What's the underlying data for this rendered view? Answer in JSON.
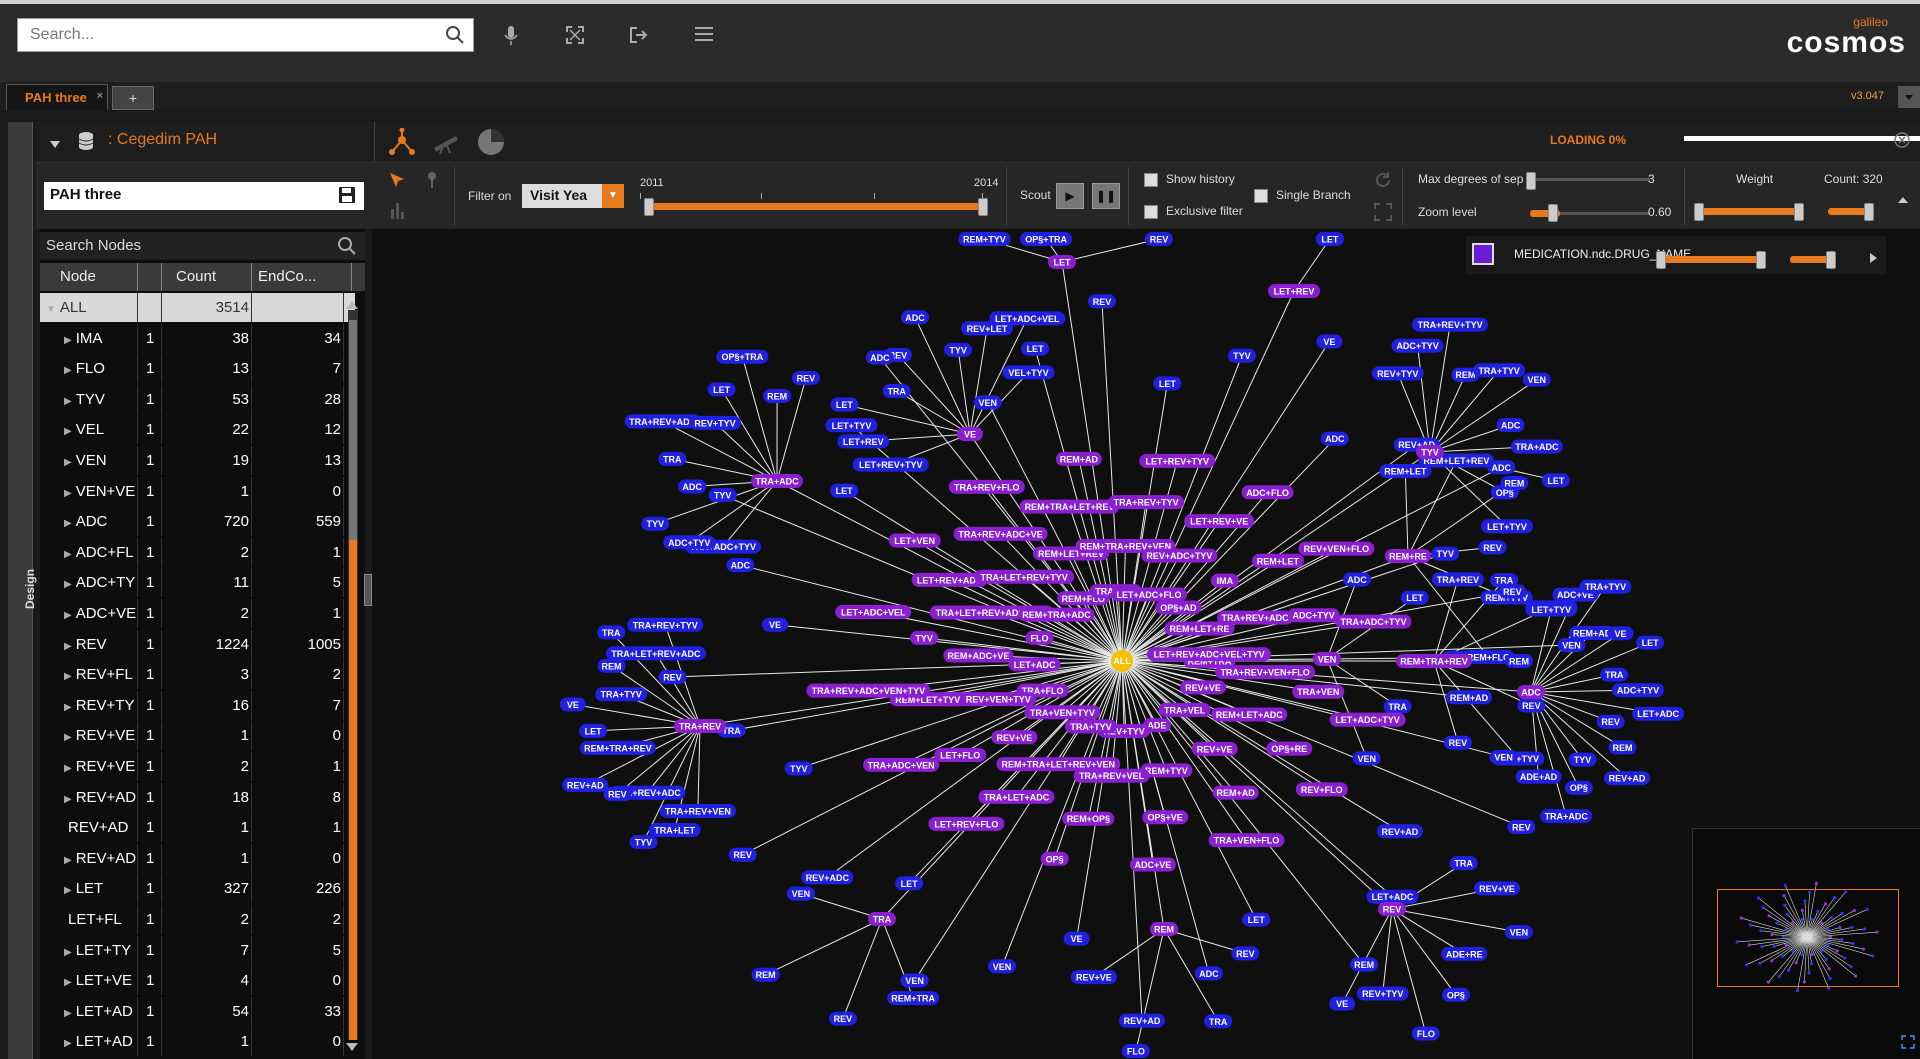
{
  "toolbar": {
    "search_placeholder": "Search...",
    "logo_small": "galileo",
    "logo_big": "cosmos"
  },
  "tabs": {
    "active_label": "PAH three",
    "close": "×",
    "add_label": "+",
    "version": "v3.047"
  },
  "sidebar_label": "Design",
  "header": {
    "dataset": ": Cegedim PAH",
    "loading": "LOADING 0%"
  },
  "filters": {
    "name_value": "PAH three",
    "filter_on": "Filter on",
    "select_value": "Visit Yea",
    "year_start": "2011",
    "year_end": "2014",
    "scout": "Scout",
    "show_history": "Show history",
    "exclusive_filter": "Exclusive filter",
    "single_branch": "Single Branch",
    "max_degrees": "Max degrees of sep",
    "max_degrees_val": "3",
    "zoom_level": "Zoom level",
    "zoom_val": "0.60",
    "weight": "Weight",
    "count": "Count: 320"
  },
  "legend_item": "MEDICATION.ndc.DRUG_NAME...",
  "nodes_panel": {
    "search": "Search Nodes",
    "col_node": "Node",
    "col_count": "Count",
    "col_end": "EndCo...",
    "rows": [
      {
        "toggle": "▼",
        "name": "ALL",
        "lvl": "",
        "count": "3514",
        "end": ""
      },
      {
        "toggle": "▶",
        "name": "IMA",
        "lvl": "1",
        "count": "38",
        "end": "34"
      },
      {
        "toggle": "▶",
        "name": "FLO",
        "lvl": "1",
        "count": "13",
        "end": "7"
      },
      {
        "toggle": "▶",
        "name": "TYV",
        "lvl": "1",
        "count": "53",
        "end": "28"
      },
      {
        "toggle": "▶",
        "name": "VEL",
        "lvl": "1",
        "count": "22",
        "end": "12"
      },
      {
        "toggle": "▶",
        "name": "VEN",
        "lvl": "1",
        "count": "19",
        "end": "13"
      },
      {
        "toggle": "▶",
        "name": "VEN+VE",
        "lvl": "1",
        "count": "1",
        "end": "0"
      },
      {
        "toggle": "▶",
        "name": "ADC",
        "lvl": "1",
        "count": "720",
        "end": "559"
      },
      {
        "toggle": "▶",
        "name": "ADC+FL",
        "lvl": "1",
        "count": "2",
        "end": "1"
      },
      {
        "toggle": "▶",
        "name": "ADC+TY",
        "lvl": "1",
        "count": "11",
        "end": "5"
      },
      {
        "toggle": "▶",
        "name": "ADC+VE",
        "lvl": "1",
        "count": "2",
        "end": "1"
      },
      {
        "toggle": "▶",
        "name": "REV",
        "lvl": "1",
        "count": "1224",
        "end": "1005"
      },
      {
        "toggle": "▶",
        "name": "REV+FL",
        "lvl": "1",
        "count": "3",
        "end": "2"
      },
      {
        "toggle": "▶",
        "name": "REV+TY",
        "lvl": "1",
        "count": "16",
        "end": "7"
      },
      {
        "toggle": "▶",
        "name": "REV+VE",
        "lvl": "1",
        "count": "1",
        "end": "0"
      },
      {
        "toggle": "▶",
        "name": "REV+VE",
        "lvl": "1",
        "count": "2",
        "end": "1"
      },
      {
        "toggle": "▶",
        "name": "REV+AD",
        "lvl": "1",
        "count": "18",
        "end": "8"
      },
      {
        "toggle": "",
        "name": "REV+AD",
        "lvl": "1",
        "count": "1",
        "end": "1"
      },
      {
        "toggle": "▶",
        "name": "REV+AD",
        "lvl": "1",
        "count": "1",
        "end": "0"
      },
      {
        "toggle": "▶",
        "name": "LET",
        "lvl": "1",
        "count": "327",
        "end": "226"
      },
      {
        "toggle": "",
        "name": "LET+FL",
        "lvl": "1",
        "count": "2",
        "end": "2"
      },
      {
        "toggle": "▶",
        "name": "LET+TY",
        "lvl": "1",
        "count": "7",
        "end": "5"
      },
      {
        "toggle": "▶",
        "name": "LET+VE",
        "lvl": "1",
        "count": "4",
        "end": "0"
      },
      {
        "toggle": "▶",
        "name": "LET+AD",
        "lvl": "1",
        "count": "54",
        "end": "33"
      },
      {
        "toggle": "▶",
        "name": "LET+AD",
        "lvl": "1",
        "count": "1",
        "end": "0"
      }
    ]
  },
  "graph": {
    "center": "ALL",
    "hubs": [
      {
        "label": "TRA+ADC",
        "leaves": [
          "TRA+ADC+TYV",
          "ADC+TYV",
          "TYV",
          "ADC",
          "TRA",
          "TRA+REV+ADC",
          "REV+TYV",
          "LET",
          "OP§+TRA",
          "REM",
          "REV"
        ]
      },
      {
        "label": "VE",
        "leaves": [
          "LET+REV+TYV",
          "LET+REV",
          "LET",
          "TRA",
          "REV",
          "ADC",
          "TYV",
          "REV+LET",
          "LET+ADC+VEL",
          "VEL+TYV"
        ]
      },
      {
        "label": "LET",
        "leaves": [
          "REM+TYV",
          "OP§+TRA",
          "REV"
        ]
      },
      {
        "label": "LET+REV",
        "leaves": [
          "LET"
        ]
      },
      {
        "label": "TYV",
        "leaves": [
          "REV+TYV",
          "ADC+TYV",
          "TRA+REV+TYV",
          "REM",
          "TRA+TYV",
          "VEN",
          "ADC",
          "TRA+ADC",
          "LET",
          "OP§",
          "LET+TYV"
        ]
      },
      {
        "label": "REM+RE",
        "leaves": [
          "REM+LET",
          "REM+LET+REV",
          "REM",
          "REV",
          "REM+TYV",
          "REM+FLO"
        ]
      },
      {
        "label": "REM+TRA+REV",
        "leaves": [
          "TRA+REV",
          "TRA",
          "REM+TRA",
          "REM",
          "REV",
          "VEN+TYV",
          "REV"
        ]
      },
      {
        "label": "VEN",
        "leaves": [
          "ADC",
          "LET",
          "VE",
          "TRA",
          "VEN"
        ]
      },
      {
        "label": "ADC",
        "leaves": [
          "LET+TYV",
          "ADC+VE",
          "TRA+TYV",
          "REM+AD",
          "VE",
          "LET",
          "TRA",
          "ADC+TYV",
          "LET+ADC",
          "REV",
          "REM",
          "REV+AD",
          "TYV",
          "OP§",
          "TRA+ADC",
          "ADE+AD"
        ]
      },
      {
        "label": "TRA+REV",
        "leaves": [
          "TRA+REV+VEN",
          "TRA+LET",
          "TYV",
          "TRA+REV+ADC",
          "REV",
          "REV+AD",
          "REM+TRA+REV",
          "LET",
          "VE",
          "TRA+TYV",
          "REM",
          "TRA",
          "TRA+LET+REV+ADC",
          "TRA+REV+TYV"
        ]
      },
      {
        "label": "REV",
        "leaves": [
          "TRA",
          "REV+VE",
          "VEN",
          "ADE+RE",
          "OP§",
          "FLO",
          "REV+TYV",
          "VE"
        ]
      },
      {
        "label": "TRA",
        "leaves": [
          "REM+TRA",
          "REV",
          "REM",
          "VEN"
        ]
      },
      {
        "label": "REM",
        "leaves": [
          "REV",
          "TRA",
          "FLO",
          "REV+VE"
        ]
      }
    ],
    "ring": [
      "REM+TRA",
      "TRA+REV+VEN+FLO",
      "TRA+VEN",
      "LET+ADC+TYV",
      "REV+VE",
      "REM+LET+ADC",
      "OP§+RE",
      "REV+FLO",
      "TRA+VEL",
      "REV+VE",
      "REM+AD",
      "TRA+VEN+FLO",
      "ADE",
      "REM+TYV",
      "OP§+VE",
      "ADC+VE",
      "REV+TYV",
      "TRA+REV+VEL",
      "REM+OP§",
      "OP§",
      "TRA+TYV",
      "REM+TRA+LET+REV+VEN",
      "TRA+LET+ADC",
      "LET+REV+FLO",
      "TRA+VEN+TYV",
      "REV+VE",
      "LET+FLO",
      "TRA+ADC+VEN",
      "TRA+FLO",
      "TRA+REV+VEN+TYV",
      "REM+LET+TYV",
      "TRA+REV+ADC+VEN+TYV",
      "LET+ADC",
      "REM+ADC+VE",
      "TYV",
      "LET+ADC+VEL",
      "FLO",
      "TRA+LET+REV+ADC+TYV",
      "LET+REV+ADC",
      "LET+VEN",
      "REM+TRA+ADC",
      "TRA+LET+REV+TYV",
      "TRA+REV+ADC+VE",
      "TRA+REV+FLO",
      "REM+FLO",
      "REM+LET+REV",
      "REM+TRA+LET+REV",
      "REM+AD",
      "TRA+LET",
      "REM+TRA+REV+VEN",
      "TRA+REV+TYV",
      "LET+REV+TYV",
      "LET+ADC+FLO",
      "REV+ADC+TYV",
      "LET+REV+VE",
      "ADC+FLO",
      "OP§+AD",
      "IMA",
      "REM+LET",
      "REV+VEN+FLO",
      "REM+LET+RE",
      "TRA+REV+ADC",
      "ADC+TYV",
      "TRA+ADC+TYV",
      "LET+REV+ADC+VEL+TYV"
    ],
    "singles": [
      "REM+AD",
      "VEN",
      "REV",
      "REV+AD",
      "LET+ADC",
      "REM",
      "LET",
      "ADC",
      "REV+AD",
      "VE",
      "VEN",
      "VEN",
      "LET",
      "REV+ADC",
      "REV",
      "TYV",
      "TRA",
      "REV",
      "VE",
      "ADC",
      "TYV",
      "LET",
      "LET+TYV",
      "ADC",
      "VEN",
      "LET",
      "REV",
      "LET",
      "TYV",
      "VE",
      "ADC",
      "REV+AD",
      "ADC",
      "TYV",
      "REV",
      "VEN"
    ]
  }
}
